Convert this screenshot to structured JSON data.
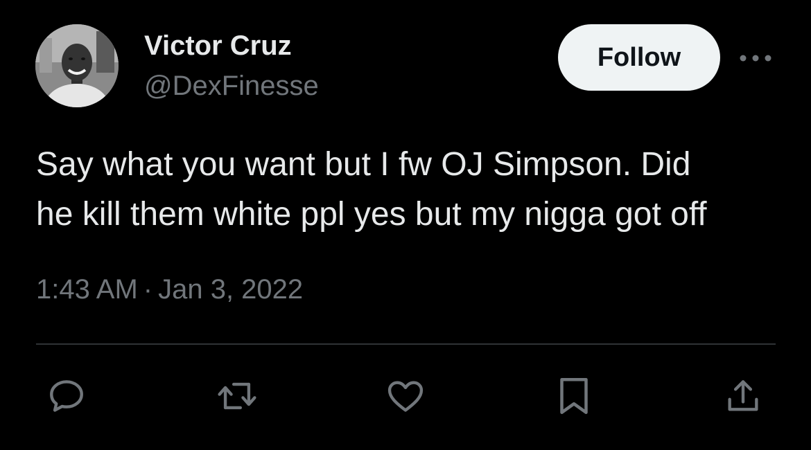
{
  "user": {
    "display_name": "Victor Cruz",
    "handle": "@DexFinesse",
    "avatar_icon": "profile-photo"
  },
  "header": {
    "follow_label": "Follow",
    "more_icon": "more-horizontal-icon"
  },
  "tweet": {
    "text": "Say what you want but I fw OJ Simpson. Did\nhe kill them white ppl yes but my nigga got off",
    "time": "1:43 AM",
    "separator": "·",
    "date": "Jan 3, 2022"
  },
  "actions": [
    {
      "icon": "reply-icon"
    },
    {
      "icon": "retweet-icon"
    },
    {
      "icon": "like-icon"
    },
    {
      "icon": "bookmark-icon"
    },
    {
      "icon": "share-icon"
    }
  ],
  "colors": {
    "background": "#000000",
    "primary_text": "#e7e9ea",
    "secondary_text": "#71767b",
    "divider": "#2f3336",
    "follow_button_bg": "#eff3f4",
    "follow_button_text": "#0f1419"
  }
}
